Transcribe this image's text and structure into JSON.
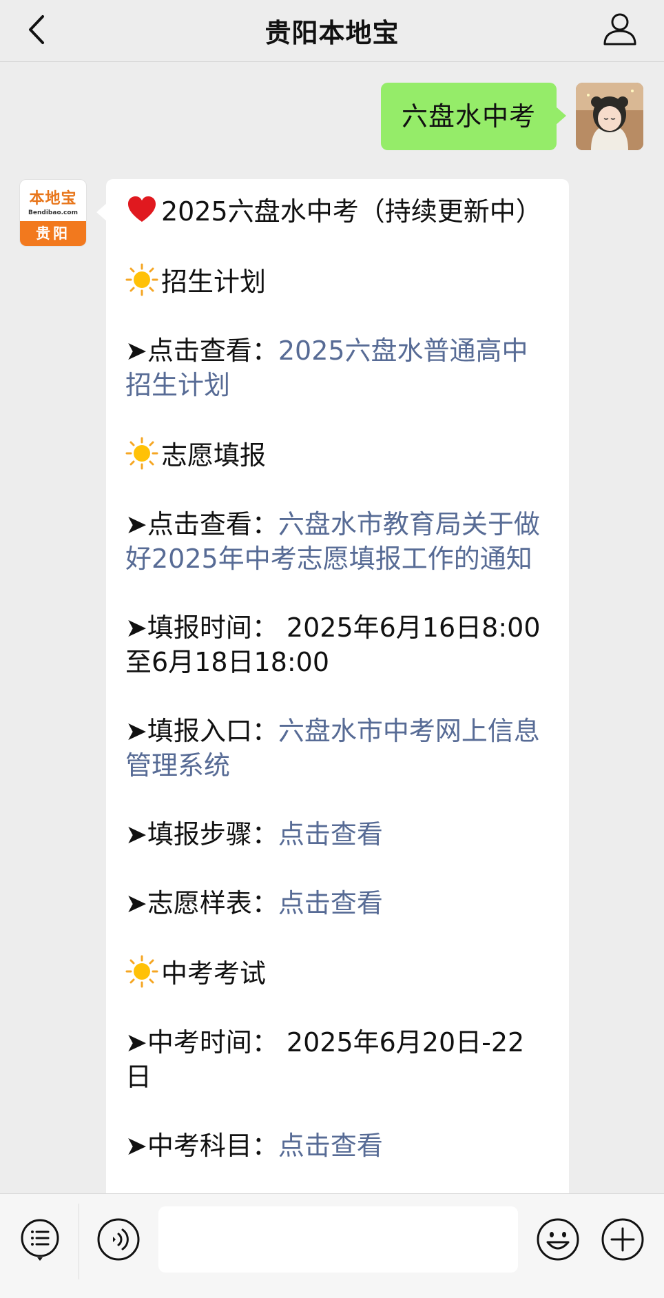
{
  "header": {
    "title": "贵阳本地宝",
    "back_icon": "chevron-left-icon",
    "user_icon": "person-icon"
  },
  "me": {
    "message": "六盘水中考"
  },
  "bot": {
    "logo": {
      "name": "本地宝",
      "site": "Bendibao.com",
      "city": "贵阳"
    },
    "heading": "2025六盘水中考（持续更新中）",
    "section1": {
      "title": "招生计划"
    },
    "item1": {
      "label": "➤点击查看：",
      "link": "2025六盘水普通高中招生计划"
    },
    "section2": {
      "title": "志愿填报"
    },
    "item2": {
      "label": "➤点击查看：",
      "link": "六盘水市教育局关于做好2025年中考志愿填报工作的通知"
    },
    "item3": {
      "text": "➤填报时间： 2025年6月16日8:00至6月18日18:00"
    },
    "item4": {
      "label": "➤填报入口：",
      "link": "六盘水市中考网上信息管理系统"
    },
    "item5": {
      "label": "➤填报步骤：",
      "link": "点击查看"
    },
    "item6": {
      "label": "➤志愿样表：",
      "link": "点击查看"
    },
    "section3": {
      "title": "中考考试"
    },
    "item7": {
      "text": "➤中考时间： 2025年6月20日-22日"
    },
    "item8": {
      "label": "➤中考科目：",
      "link": "点击查看"
    }
  },
  "colors": {
    "my_bubble": "#95ec69",
    "link": "#576b95",
    "logo_orange": "#f2791e"
  },
  "toolbar": {
    "menu_icon": "list-menu-icon",
    "voice_icon": "voice-icon",
    "emoji_icon": "smiley-icon",
    "plus_icon": "plus-icon",
    "input_value": ""
  }
}
